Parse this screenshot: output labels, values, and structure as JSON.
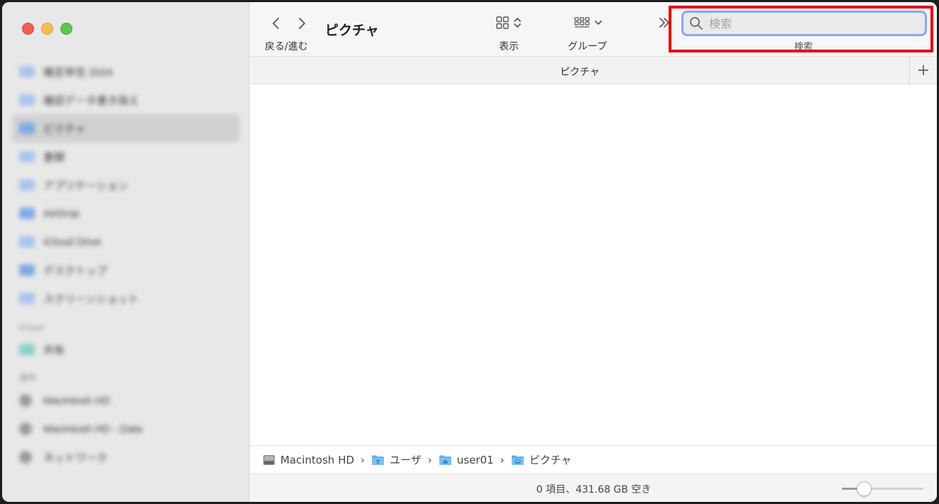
{
  "window": {
    "title": "ピクチャ"
  },
  "toolbar": {
    "nav_label": "戻る/進む",
    "view_label": "表示",
    "group_label": "グループ",
    "search_label": "検索"
  },
  "search": {
    "placeholder": "検索",
    "value": ""
  },
  "tabbar": {
    "title": "ピクチャ",
    "add": "+"
  },
  "sidebar": {
    "items": [
      {
        "label": "確定申告 2024",
        "icon": "folder-icon"
      },
      {
        "label": "確認データ書き換え",
        "icon": "folder-icon"
      },
      {
        "label": "ピクチャ",
        "icon": "pictures-folder-icon",
        "selected": true
      },
      {
        "label": "書類",
        "icon": "document-icon"
      },
      {
        "label": "アプリケーション",
        "icon": "applications-icon"
      },
      {
        "label": "AirDrop",
        "icon": "airdrop-icon"
      },
      {
        "label": "iCloud Drive",
        "icon": "cloud-icon"
      },
      {
        "label": "デスクトップ",
        "icon": "desktop-icon"
      },
      {
        "label": "スクリーンショット",
        "icon": "folder-icon"
      }
    ],
    "section_shared": "iCloud",
    "shared_items": [
      {
        "label": "共有",
        "icon": "shared-folder-icon"
      }
    ],
    "section_locations": "場所",
    "locations": [
      {
        "label": "Macintosh HD",
        "icon": "disk-icon"
      },
      {
        "label": "Macintosh HD - Data",
        "icon": "disk-icon"
      },
      {
        "label": "ネットワーク",
        "icon": "network-icon"
      }
    ]
  },
  "pathbar": {
    "items": [
      {
        "label": "Macintosh HD",
        "icon": "hard-disk-icon"
      },
      {
        "label": "ユーザ",
        "icon": "users-folder-icon"
      },
      {
        "label": "user01",
        "icon": "home-folder-icon"
      },
      {
        "label": "ピクチャ",
        "icon": "pictures-folder-icon"
      }
    ],
    "separator": "›"
  },
  "status": {
    "text": "0 項目、431.68 GB 空き"
  },
  "zoom_slider": {
    "level": 0.27
  },
  "colors": {
    "accent": "#8aa6ef",
    "highlight": "#e4000f",
    "folder": "#63aee8"
  }
}
